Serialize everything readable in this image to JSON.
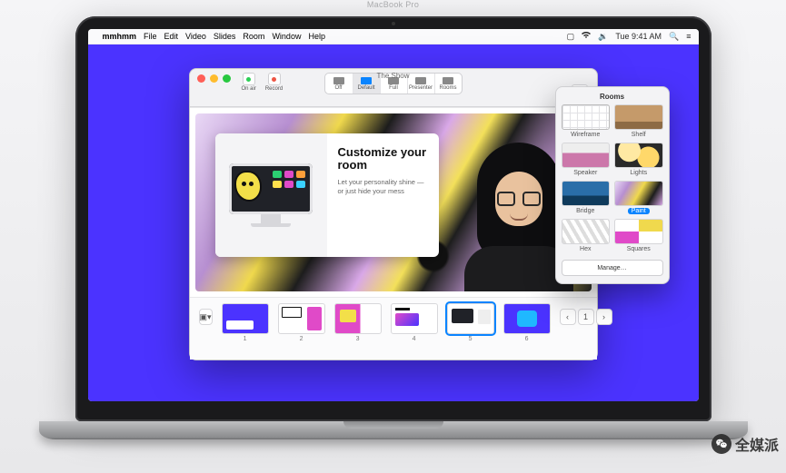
{
  "menubar": {
    "app": "mmhmm",
    "items": [
      "File",
      "Edit",
      "Video",
      "Slides",
      "Room",
      "Window",
      "Help"
    ],
    "clock": "Tue 9:41 AM"
  },
  "window": {
    "title": "The Show",
    "toolbar_left": {
      "onair": "On air",
      "record": "Record"
    },
    "toolbar_modes": [
      {
        "key": "off",
        "label": "Off"
      },
      {
        "key": "default",
        "label": "Default"
      },
      {
        "key": "full",
        "label": "Full"
      },
      {
        "key": "presenter",
        "label": "Presenter"
      },
      {
        "key": "rooms",
        "label": "Rooms"
      }
    ],
    "toolbar_active_mode": "default",
    "toolbar_right": {
      "camera": "Camera"
    }
  },
  "slide_card": {
    "heading": "Customize your room",
    "body": "Let your personality shine — or just hide your mess"
  },
  "tray": {
    "pager": {
      "page": "1"
    },
    "slides": [
      {
        "n": "1"
      },
      {
        "n": "2"
      },
      {
        "n": "3"
      },
      {
        "n": "4"
      },
      {
        "n": "5"
      },
      {
        "n": "6"
      }
    ],
    "selected": 5
  },
  "rooms_panel": {
    "title": "Rooms",
    "items": [
      {
        "key": "wireframe",
        "label": "Wireframe"
      },
      {
        "key": "shelf",
        "label": "Shelf"
      },
      {
        "key": "speaker",
        "label": "Speaker"
      },
      {
        "key": "lights",
        "label": "Lights"
      },
      {
        "key": "bridge",
        "label": "Bridge"
      },
      {
        "key": "paint",
        "label": "Paint"
      },
      {
        "key": "hex",
        "label": "Hex"
      },
      {
        "key": "squares",
        "label": "Squares"
      }
    ],
    "selected": "paint",
    "manage": "Manage…"
  },
  "laptop_label": "MacBook Pro",
  "watermark": "全媒派"
}
